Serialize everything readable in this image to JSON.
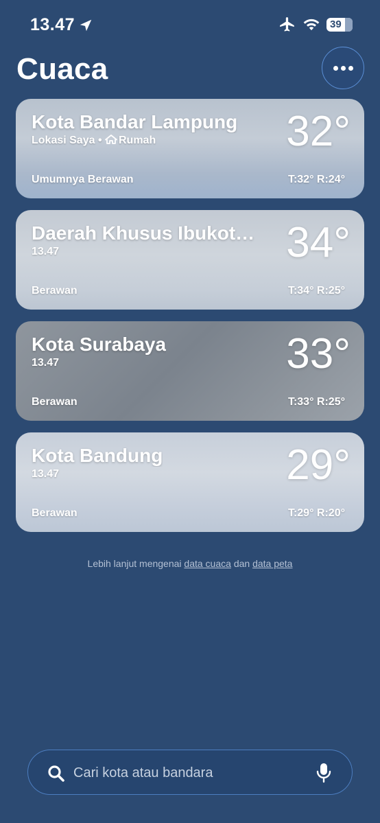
{
  "status_bar": {
    "time": "13.47",
    "battery": "39"
  },
  "header": {
    "title": "Cuaca",
    "more_icon": "ellipsis-icon"
  },
  "cities": [
    {
      "name": "Kota Bandar Lampung",
      "subtitle_prefix": "Lokasi Saya •",
      "subtitle_home": "Rumah",
      "temp": "32°",
      "condition": "Umumnya Berawan",
      "hilo": "T:32°  R:24°"
    },
    {
      "name": "Daerah Khusus Ibukota Jakarta",
      "subtitle": "13.47",
      "temp": "34°",
      "condition": "Berawan",
      "hilo": "T:34°  R:25°"
    },
    {
      "name": "Kota Surabaya",
      "subtitle": "13.47",
      "temp": "33°",
      "condition": "Berawan",
      "hilo": "T:33°  R:25°"
    },
    {
      "name": "Kota Bandung",
      "subtitle": "13.47",
      "temp": "29°",
      "condition": "Berawan",
      "hilo": "T:29°  R:20°"
    }
  ],
  "footer": {
    "prefix": "Lebih lanjut mengenai",
    "link1": "data cuaca",
    "conj": "dan",
    "link2": "data peta"
  },
  "search": {
    "placeholder": "Cari kota atau bandara"
  },
  "colors": {
    "background": "#2c4a72",
    "accent_border": "#4d7ec0"
  }
}
